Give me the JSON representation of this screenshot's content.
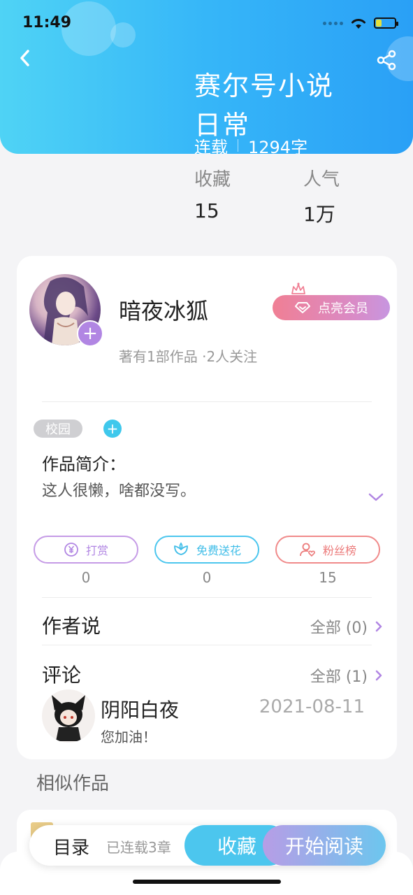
{
  "status_bar": {
    "time": "11:49"
  },
  "book": {
    "title": "赛尔号小说",
    "type": "日常",
    "status": "连载",
    "word_count": "1294字",
    "stats": [
      {
        "label": "收藏",
        "value": "15"
      },
      {
        "label": "人气",
        "value": "1万"
      }
    ]
  },
  "author": {
    "name": "暗夜冰狐",
    "meta": "著有1部作品 ·2人关注",
    "vip_label": "点亮会员"
  },
  "tags": [
    "校园"
  ],
  "intro": {
    "label": "作品简介：",
    "text": "这人很懒，啥都没写。"
  },
  "actions": [
    {
      "label": "打赏",
      "count": "0"
    },
    {
      "label": "免费送花",
      "count": "0"
    },
    {
      "label": "粉丝榜",
      "count": "15"
    }
  ],
  "author_says": {
    "title": "作者说",
    "more": "全部 (0)"
  },
  "comments": {
    "title": "评论",
    "more": "全部 (1)",
    "items": [
      {
        "user": "阴阳白夜",
        "date": "2021-08-11",
        "text": "您加油！"
      }
    ]
  },
  "similar": {
    "title": "相似作品"
  },
  "bottom": {
    "toc_label": "目录",
    "toc_info": "已连载3章",
    "fav_label": "收藏",
    "read_label": "开始阅读"
  },
  "colors": {
    "accent_blue": "#36b6f8",
    "purple": "#b186e3",
    "pink": "#f07f94",
    "cyan": "#3fc8ec"
  }
}
